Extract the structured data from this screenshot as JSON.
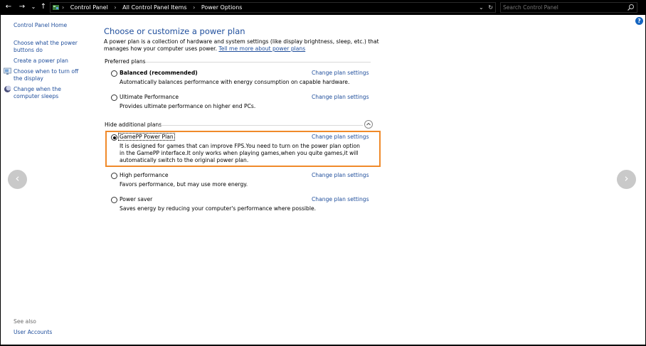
{
  "nav": {
    "back": "←",
    "forward": "→",
    "recent": "⌄",
    "up": "↑"
  },
  "address": {
    "crumbs": [
      "Control Panel",
      "All Control Panel Items",
      "Power Options"
    ],
    "separator": "›",
    "dropdown": "⌄",
    "refresh": "↻"
  },
  "search": {
    "placeholder": "Search Control Panel"
  },
  "help": "?",
  "sidebar": {
    "home": "Control Panel Home",
    "items": [
      {
        "label": "Choose what the power buttons do"
      },
      {
        "label": "Create a power plan"
      },
      {
        "label": "Choose when to turn off the display",
        "icon": "display-icon"
      },
      {
        "label": "Change when the computer sleeps",
        "icon": "moon-icon"
      }
    ],
    "see_also": "See also",
    "user_accounts": "User Accounts"
  },
  "main": {
    "title": "Choose or customize a power plan",
    "intro": "A power plan is a collection of hardware and system settings (like display brightness, sleep, etc.) that manages how your computer uses power. ",
    "intro_link": "Tell me more about power plans",
    "preferred_header": "Preferred plans",
    "hidden_header": "Hide additional plans",
    "change_label": "Change plan settings",
    "preferred_plans": [
      {
        "name": "Balanced (recommended)",
        "desc": "Automatically balances performance with energy consumption on capable hardware.",
        "selected": false
      },
      {
        "name": "Ultimate Performance",
        "desc": "Provides ultimate performance on higher end PCs.",
        "selected": false
      }
    ],
    "additional_plans": [
      {
        "name": "GamePP Power Plan",
        "desc": "It is designed for games that can improve FPS.You need to turn on the power plan option in the GamePP interface.It  only works when playing games,when you quite games,it will automatically switch to the original power plan.",
        "selected": true
      },
      {
        "name": "High performance",
        "desc": "Favors performance, but may use more energy.",
        "selected": false
      },
      {
        "name": "Power saver",
        "desc": "Saves energy by reducing your computer's performance where possible.",
        "selected": false
      }
    ]
  },
  "arrows": {
    "left": "‹",
    "right": "›"
  },
  "colors": {
    "highlight": "#f08a2a",
    "link": "#1e4d9b",
    "title": "#1f4e9c"
  }
}
